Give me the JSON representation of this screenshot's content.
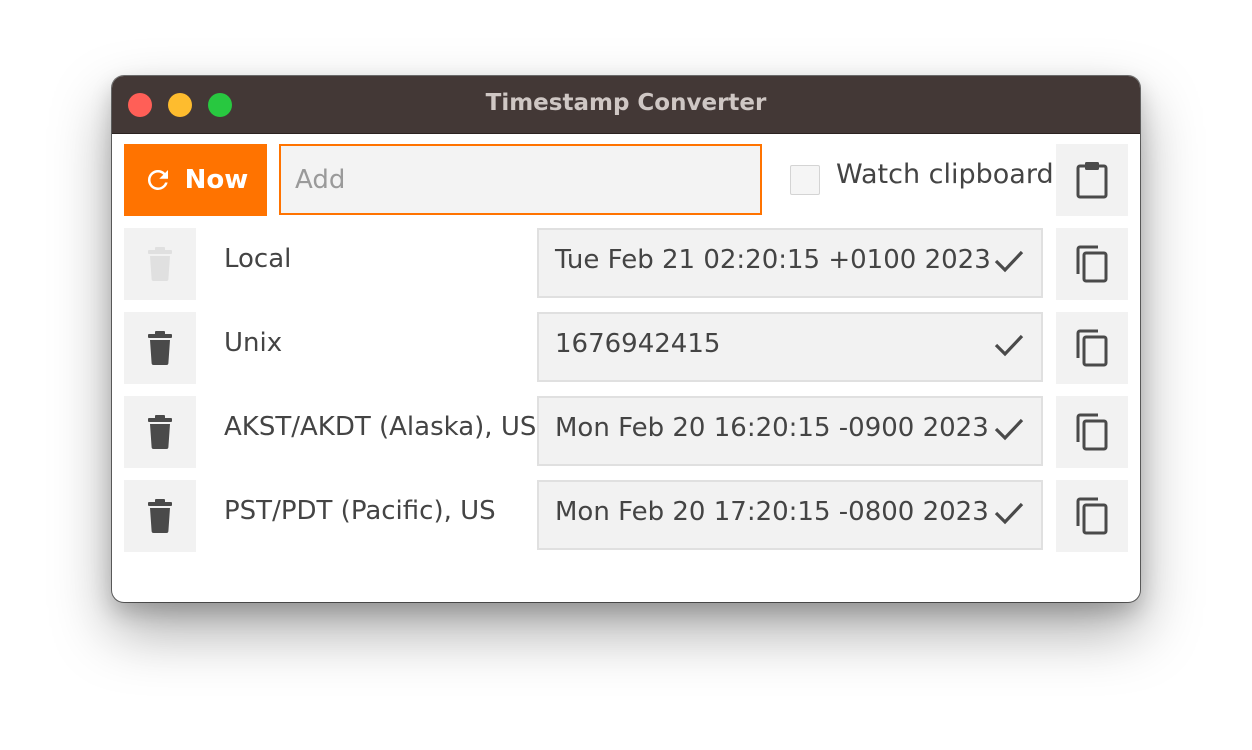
{
  "window": {
    "title": "Timestamp Converter"
  },
  "toolbar": {
    "now_label": "Now",
    "add_placeholder": "Add",
    "add_value": "",
    "watch_clipboard_label": "Watch clipboard",
    "watch_clipboard_checked": false
  },
  "colors": {
    "accent": "#ff7300",
    "titlebar": "#433836",
    "close": "#ff5f57",
    "minimize": "#febc2e",
    "maximize": "#28c840"
  },
  "rows": [
    {
      "label": "Local",
      "value": "Tue Feb 21 02:20:15 +0100 2023",
      "delete_enabled": false
    },
    {
      "label": "Unix",
      "value": "1676942415",
      "delete_enabled": true
    },
    {
      "label": "AKST/AKDT (Alaska), US",
      "value": "Mon Feb 20 16:20:15 -0900 2023",
      "delete_enabled": true
    },
    {
      "label": "PST/PDT (Pacific), US",
      "value": "Mon Feb 20 17:20:15 -0800 2023",
      "delete_enabled": true
    }
  ],
  "icons": {
    "now": "refresh-icon",
    "paste": "clipboard-icon",
    "delete": "trash-icon",
    "confirm": "checkmark-icon",
    "copy": "copy-icon"
  }
}
